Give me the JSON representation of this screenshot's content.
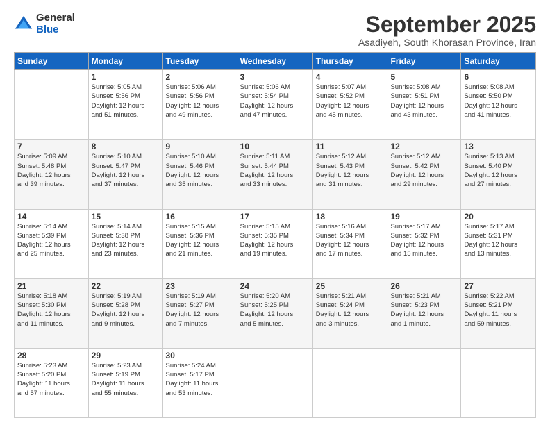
{
  "logo": {
    "general": "General",
    "blue": "Blue"
  },
  "header": {
    "month": "September 2025",
    "location": "Asadiyeh, South Khorasan Province, Iran"
  },
  "weekdays": [
    "Sunday",
    "Monday",
    "Tuesday",
    "Wednesday",
    "Thursday",
    "Friday",
    "Saturday"
  ],
  "weeks": [
    [
      {
        "day": "",
        "info": ""
      },
      {
        "day": "1",
        "info": "Sunrise: 5:05 AM\nSunset: 5:56 PM\nDaylight: 12 hours\nand 51 minutes."
      },
      {
        "day": "2",
        "info": "Sunrise: 5:06 AM\nSunset: 5:56 PM\nDaylight: 12 hours\nand 49 minutes."
      },
      {
        "day": "3",
        "info": "Sunrise: 5:06 AM\nSunset: 5:54 PM\nDaylight: 12 hours\nand 47 minutes."
      },
      {
        "day": "4",
        "info": "Sunrise: 5:07 AM\nSunset: 5:52 PM\nDaylight: 12 hours\nand 45 minutes."
      },
      {
        "day": "5",
        "info": "Sunrise: 5:08 AM\nSunset: 5:51 PM\nDaylight: 12 hours\nand 43 minutes."
      },
      {
        "day": "6",
        "info": "Sunrise: 5:08 AM\nSunset: 5:50 PM\nDaylight: 12 hours\nand 41 minutes."
      }
    ],
    [
      {
        "day": "7",
        "info": "Sunrise: 5:09 AM\nSunset: 5:48 PM\nDaylight: 12 hours\nand 39 minutes."
      },
      {
        "day": "8",
        "info": "Sunrise: 5:10 AM\nSunset: 5:47 PM\nDaylight: 12 hours\nand 37 minutes."
      },
      {
        "day": "9",
        "info": "Sunrise: 5:10 AM\nSunset: 5:46 PM\nDaylight: 12 hours\nand 35 minutes."
      },
      {
        "day": "10",
        "info": "Sunrise: 5:11 AM\nSunset: 5:44 PM\nDaylight: 12 hours\nand 33 minutes."
      },
      {
        "day": "11",
        "info": "Sunrise: 5:12 AM\nSunset: 5:43 PM\nDaylight: 12 hours\nand 31 minutes."
      },
      {
        "day": "12",
        "info": "Sunrise: 5:12 AM\nSunset: 5:42 PM\nDaylight: 12 hours\nand 29 minutes."
      },
      {
        "day": "13",
        "info": "Sunrise: 5:13 AM\nSunset: 5:40 PM\nDaylight: 12 hours\nand 27 minutes."
      }
    ],
    [
      {
        "day": "14",
        "info": "Sunrise: 5:14 AM\nSunset: 5:39 PM\nDaylight: 12 hours\nand 25 minutes."
      },
      {
        "day": "15",
        "info": "Sunrise: 5:14 AM\nSunset: 5:38 PM\nDaylight: 12 hours\nand 23 minutes."
      },
      {
        "day": "16",
        "info": "Sunrise: 5:15 AM\nSunset: 5:36 PM\nDaylight: 12 hours\nand 21 minutes."
      },
      {
        "day": "17",
        "info": "Sunrise: 5:15 AM\nSunset: 5:35 PM\nDaylight: 12 hours\nand 19 minutes."
      },
      {
        "day": "18",
        "info": "Sunrise: 5:16 AM\nSunset: 5:34 PM\nDaylight: 12 hours\nand 17 minutes."
      },
      {
        "day": "19",
        "info": "Sunrise: 5:17 AM\nSunset: 5:32 PM\nDaylight: 12 hours\nand 15 minutes."
      },
      {
        "day": "20",
        "info": "Sunrise: 5:17 AM\nSunset: 5:31 PM\nDaylight: 12 hours\nand 13 minutes."
      }
    ],
    [
      {
        "day": "21",
        "info": "Sunrise: 5:18 AM\nSunset: 5:30 PM\nDaylight: 12 hours\nand 11 minutes."
      },
      {
        "day": "22",
        "info": "Sunrise: 5:19 AM\nSunset: 5:28 PM\nDaylight: 12 hours\nand 9 minutes."
      },
      {
        "day": "23",
        "info": "Sunrise: 5:19 AM\nSunset: 5:27 PM\nDaylight: 12 hours\nand 7 minutes."
      },
      {
        "day": "24",
        "info": "Sunrise: 5:20 AM\nSunset: 5:25 PM\nDaylight: 12 hours\nand 5 minutes."
      },
      {
        "day": "25",
        "info": "Sunrise: 5:21 AM\nSunset: 5:24 PM\nDaylight: 12 hours\nand 3 minutes."
      },
      {
        "day": "26",
        "info": "Sunrise: 5:21 AM\nSunset: 5:23 PM\nDaylight: 12 hours\nand 1 minute."
      },
      {
        "day": "27",
        "info": "Sunrise: 5:22 AM\nSunset: 5:21 PM\nDaylight: 11 hours\nand 59 minutes."
      }
    ],
    [
      {
        "day": "28",
        "info": "Sunrise: 5:23 AM\nSunset: 5:20 PM\nDaylight: 11 hours\nand 57 minutes."
      },
      {
        "day": "29",
        "info": "Sunrise: 5:23 AM\nSunset: 5:19 PM\nDaylight: 11 hours\nand 55 minutes."
      },
      {
        "day": "30",
        "info": "Sunrise: 5:24 AM\nSunset: 5:17 PM\nDaylight: 11 hours\nand 53 minutes."
      },
      {
        "day": "",
        "info": ""
      },
      {
        "day": "",
        "info": ""
      },
      {
        "day": "",
        "info": ""
      },
      {
        "day": "",
        "info": ""
      }
    ]
  ]
}
